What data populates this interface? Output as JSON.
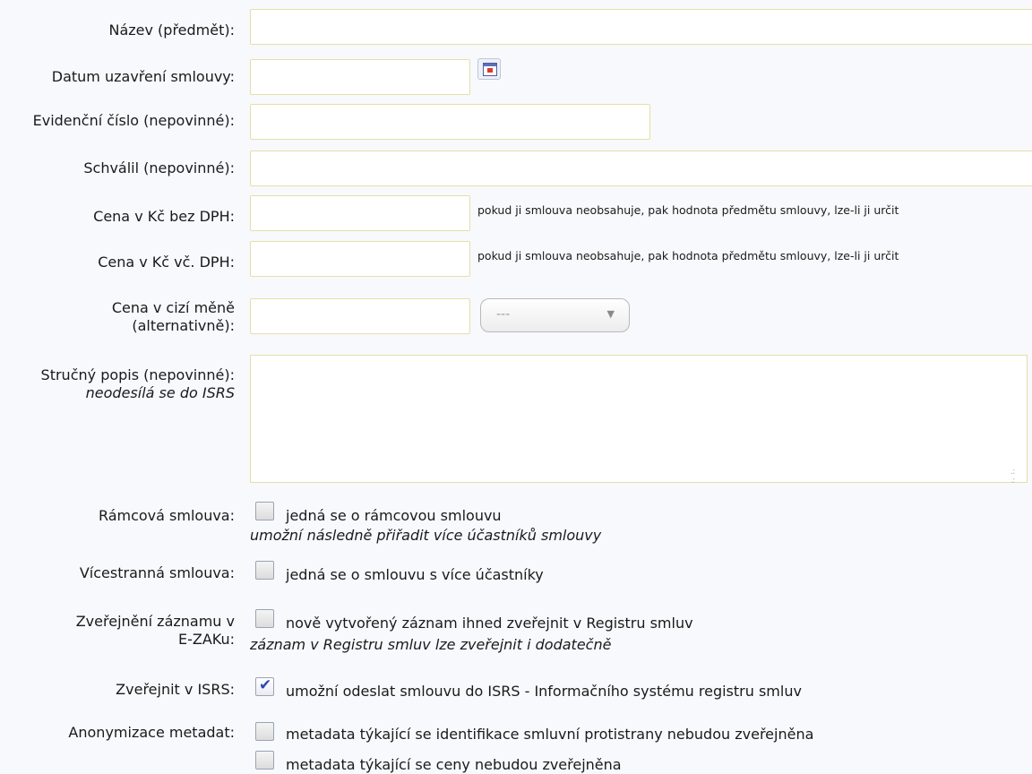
{
  "fields": {
    "nazev": {
      "label": "Název (předmět):",
      "value": ""
    },
    "datum": {
      "label": "Datum uzavření smlouvy:",
      "value": "",
      "icon": "calendar-icon"
    },
    "evidencni": {
      "label": "Evidenční číslo (nepovinné):",
      "value": ""
    },
    "schvalil": {
      "label": "Schválil (nepovinné):",
      "value": ""
    },
    "cena_bez_dph": {
      "label": "Cena v Kč bez DPH:",
      "value": "",
      "hint": "pokud ji smlouva neobsahuje, pak hodnota předmětu smlouvy, lze-li ji určit"
    },
    "cena_vc_dph": {
      "label": "Cena v Kč vč. DPH:",
      "value": "",
      "hint": "pokud ji smlouva neobsahuje, pak hodnota předmětu smlouvy, lze-li ji určit"
    },
    "cena_cizi": {
      "label_line1": "Cena v cizí měně",
      "label_line2": "(alternativně):",
      "value": "",
      "currency_selected": "---"
    },
    "popis": {
      "label_line1": "Stručný popis (nepovinné):",
      "label_note": "neodesílá se do ISRS",
      "value": ""
    }
  },
  "checkboxes": {
    "ramcova": {
      "label": "Rámcová smlouva:",
      "text": "jedná se o rámcovou smlouvu",
      "note": "umožní následně přiřadit více účastníků smlouvy",
      "checked": false
    },
    "vicestranna": {
      "label": "Vícestranná smlouva:",
      "text": "jedná se o smlouvu s více účastníky",
      "checked": false
    },
    "zverejneni": {
      "label_line1": "Zveřejnění záznamu v",
      "label_line2": "E-ZAKu:",
      "text": "nově vytvořený záznam ihned zveřejnit v Registru smluv",
      "note": "záznam v Registru smluv lze zveřejnit i dodatečně",
      "checked": false
    },
    "isrs": {
      "label": "Zveřejnit v ISRS:",
      "text": "umožní odeslat smlouvu do ISRS - Informačního systému registru smluv",
      "checked": true
    },
    "anonymizace": {
      "label": "Anonymizace metadat:",
      "text1": "metadata týkající se identifikace smluvní protistrany nebudou zveřejněna",
      "text2": "metadata týkající se ceny nebudou zveřejněna",
      "checked1": false,
      "checked2": false
    }
  },
  "colors": {
    "input_border": "#e6dfa8",
    "background": "#f7f9fc",
    "check_mark": "#2f47b8"
  }
}
